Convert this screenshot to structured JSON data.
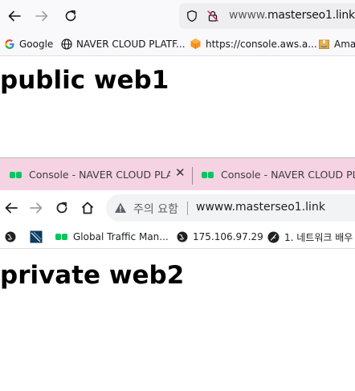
{
  "top_browser": {
    "url_prefix": "wwww.",
    "url_domain": "masterseo1.link",
    "bookmarks": [
      {
        "label": "Google",
        "icon": "google-icon"
      },
      {
        "label": "NAVER CLOUD PLATF...",
        "icon": "globe-icon"
      },
      {
        "label": "https://console.aws.a...",
        "icon": "aws-cube-icon"
      },
      {
        "label": "Amaz",
        "icon": "amazon-box-icon"
      }
    ],
    "page_heading": "public web1"
  },
  "bottom_browser": {
    "tabs": [
      {
        "label": "Console - NAVER CLOUD PLATF",
        "icon": "naver-cloud-icon"
      },
      {
        "label": "Console - NAVER CLOUD PLATF",
        "icon": "naver-cloud-icon"
      }
    ],
    "security_warning": "주의 요함",
    "url": "wwww.masterseo1.link",
    "bookmarks": [
      {
        "label": "",
        "icon": "globe-icon"
      },
      {
        "label": "",
        "icon": "site-favicon"
      },
      {
        "label": "Global Traffic Man...",
        "icon": "naver-cloud-icon"
      },
      {
        "label": "175.106.97.29",
        "icon": "globe-icon"
      },
      {
        "label": "1. 네트워크 배우",
        "icon": "feather-icon"
      }
    ],
    "page_heading": "private web2"
  },
  "colors": {
    "tab_strip": "#f5d3e3",
    "naver_green": "#03c75a",
    "aws_orange": "#f7931e"
  }
}
